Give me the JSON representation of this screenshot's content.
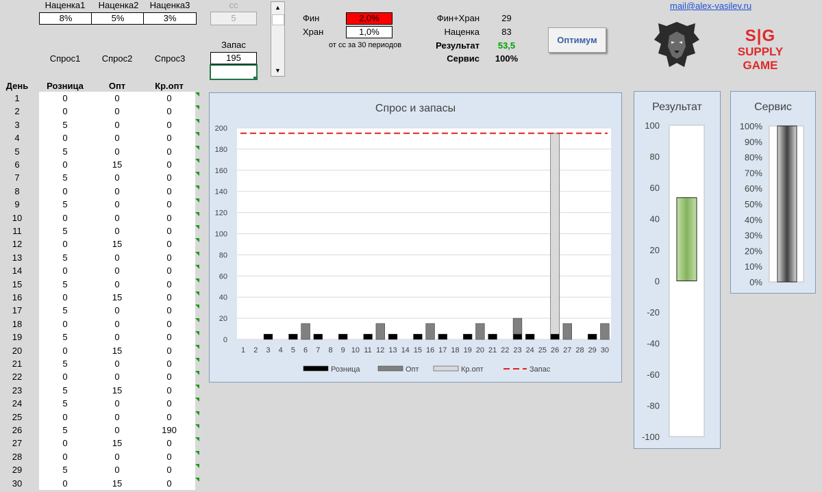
{
  "header": {
    "markup_labels": [
      "Наценка1",
      "Наценка2",
      "Наценка3"
    ],
    "markup_values": [
      "8%",
      "5%",
      "3%"
    ],
    "cc_label": "сс",
    "cc_value": "5",
    "stock_label": "Запас",
    "stock_value": "195",
    "demand_labels": [
      "Спрос1",
      "Спрос2",
      "Спрос3"
    ],
    "fin_label": "Фин",
    "fin_value": "2,0%",
    "stor_label": "Хран",
    "stor_value": "1,0%",
    "note": "от сс за 30 периодов",
    "fin_stor_label": "Фин+Хран",
    "fin_stor_value": "29",
    "markup_label": "Наценка",
    "markup_value": "83",
    "result_label": "Результат",
    "result_value": "53,5",
    "service_label": "Сервис",
    "service_value": "100%",
    "optimum_button": "Оптимум",
    "email": "mail@alex-vasilev.ru",
    "brand_line1": "S|G",
    "brand_line2": "SUPPLY GAME"
  },
  "table": {
    "col_headers": [
      "День",
      "Розница",
      "Опт",
      "Кр.опт"
    ],
    "days": [
      "1",
      "2",
      "3",
      "4",
      "5",
      "6",
      "7",
      "8",
      "9",
      "10",
      "11",
      "12",
      "13",
      "14",
      "15",
      "16",
      "17",
      "18",
      "19",
      "20",
      "21",
      "22",
      "23",
      "24",
      "25",
      "26",
      "27",
      "28",
      "29",
      "30"
    ],
    "retail": [
      "0",
      "0",
      "5",
      "0",
      "5",
      "0",
      "5",
      "0",
      "5",
      "0",
      "5",
      "0",
      "5",
      "0",
      "5",
      "0",
      "5",
      "0",
      "5",
      "0",
      "5",
      "0",
      "5",
      "5",
      "0",
      "5",
      "0",
      "0",
      "5",
      "0"
    ],
    "wholesale": [
      "0",
      "0",
      "0",
      "0",
      "0",
      "15",
      "0",
      "0",
      "0",
      "0",
      "0",
      "15",
      "0",
      "0",
      "0",
      "15",
      "0",
      "0",
      "0",
      "15",
      "0",
      "0",
      "15",
      "0",
      "0",
      "0",
      "15",
      "0",
      "0",
      "15"
    ],
    "large": [
      "0",
      "0",
      "0",
      "0",
      "0",
      "0",
      "0",
      "0",
      "0",
      "0",
      "0",
      "0",
      "0",
      "0",
      "0",
      "0",
      "0",
      "0",
      "0",
      "0",
      "0",
      "0",
      "0",
      "0",
      "0",
      "190",
      "0",
      "0",
      "0",
      "0"
    ]
  },
  "chart_data": [
    {
      "type": "bar",
      "stacked": true,
      "title": "Спрос и запасы",
      "categories": [
        "1",
        "2",
        "3",
        "4",
        "5",
        "6",
        "7",
        "8",
        "9",
        "10",
        "11",
        "12",
        "13",
        "14",
        "15",
        "16",
        "17",
        "18",
        "19",
        "20",
        "21",
        "22",
        "23",
        "24",
        "25",
        "26",
        "27",
        "28",
        "29",
        "30"
      ],
      "series": [
        {
          "name": "Розница",
          "color": "#000000",
          "values": [
            0,
            0,
            5,
            0,
            5,
            0,
            5,
            0,
            5,
            0,
            5,
            0,
            5,
            0,
            5,
            0,
            5,
            0,
            5,
            0,
            5,
            0,
            5,
            5,
            0,
            5,
            0,
            0,
            5,
            0
          ]
        },
        {
          "name": "Опт",
          "color": "#808080",
          "values": [
            0,
            0,
            0,
            0,
            0,
            15,
            0,
            0,
            0,
            0,
            0,
            15,
            0,
            0,
            0,
            15,
            0,
            0,
            0,
            15,
            0,
            0,
            15,
            0,
            0,
            0,
            15,
            0,
            0,
            15
          ]
        },
        {
          "name": "Кр.опт",
          "color": "#d9d9d9",
          "values": [
            0,
            0,
            0,
            0,
            0,
            0,
            0,
            0,
            0,
            0,
            0,
            0,
            0,
            0,
            0,
            0,
            0,
            0,
            0,
            0,
            0,
            0,
            0,
            0,
            0,
            190,
            0,
            0,
            0,
            0
          ]
        }
      ],
      "line": {
        "name": "Запас",
        "color": "#e02020",
        "style": "dashed",
        "value": 195
      },
      "ylim": [
        0,
        200
      ],
      "yticks": [
        "0",
        "20",
        "40",
        "60",
        "80",
        "100",
        "120",
        "140",
        "160",
        "180",
        "200"
      ],
      "legend": "bottom",
      "grid": true
    },
    {
      "type": "bar",
      "title": "Результат",
      "value": 53.5,
      "ylim": [
        -100,
        100
      ],
      "yticks": [
        "100",
        "80",
        "60",
        "40",
        "20",
        "0",
        "-20",
        "-40",
        "-60",
        "-80",
        "-100"
      ],
      "color": "#8fbc6a"
    },
    {
      "type": "bar",
      "title": "Сервис",
      "value": 1.0,
      "ylim": [
        0,
        1
      ],
      "yticks": [
        "100%",
        "90%",
        "80%",
        "70%",
        "60%",
        "50%",
        "40%",
        "30%",
        "20%",
        "10%",
        "0%"
      ],
      "color": "#707070"
    }
  ]
}
